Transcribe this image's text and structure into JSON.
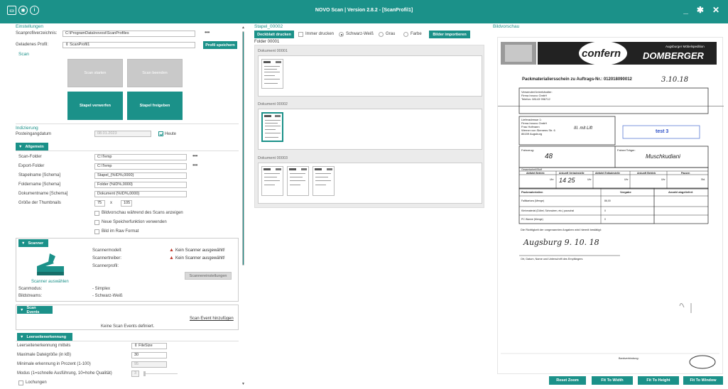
{
  "titlebar": {
    "title": "NOVO Scan  |  Version  2.8.2   -   [ScanProfil1]",
    "icons": [
      "scanner-icon",
      "gear-icon",
      "info-icon"
    ],
    "window_controls": [
      "_",
      "✱",
      "✕"
    ]
  },
  "left": {
    "einstellungen": "Einstellungen",
    "scanprofil_label": "Scanprofilverzeichnis:",
    "scanprofil_value": "C:\\ProgramData\\novosi\\ScanProfiles",
    "geladenes_label": "Geladenes Profil:",
    "geladenes_value": "ScanProfil1",
    "profil_speichern": "Profil speichern",
    "scan_title": "Scan",
    "scan_starten": "Scan starten",
    "scan_beenden": "Scan beenden",
    "stapel_verwerfen": "Stapel verwerfen",
    "stapel_freigeben": "Stapel freigeben",
    "indizierung_title": "Indizierung",
    "posteingang_label": "Posteingangdatum",
    "posteingang_value": "08.01.2023",
    "heute": "Heute",
    "allgemein": {
      "header": "Allgemein",
      "scan_folder_label": "Scan-Folder",
      "scan_folder_value": "C:\\Temp",
      "export_folder_label": "Export-Folder",
      "export_folder_value": "C:\\Temp",
      "stapelname_label": "Stapelname [Schema]",
      "stapelname_value": "Stapel_{%ID%,0000}",
      "foldername_label": "Foldername [Schema]",
      "foldername_value": "Folder {%ID%,0000}",
      "dokumentname_label": "Dokumentname [Schema]",
      "dokumentname_value": "Dokument {%ID%,0000}",
      "thumbs_label": "Größe der Thumbnails",
      "thumbs_w": "75",
      "thumbs_x": "x",
      "thumbs_h": "105",
      "cb1": "Bildvorschau während des Scans anzeigen",
      "cb2": "Neue Speicherfunktion verwenden",
      "cb3": "Bild im Raw Format"
    },
    "scanner": {
      "header": "Scanner",
      "scanner_auswaehlen": "Scanner auswählen",
      "modell_label": "Scannermodell:",
      "treiber_label": "Scannertreiber:",
      "profil_label": "Scannerprofil:",
      "modell_warn": "Kein Scanner ausgewählt!",
      "treiber_warn": "Kein Scanner ausgewählt!",
      "einstellungen_btn": "Scannereinstellungen",
      "modus_label": "Scanmodus:",
      "modus_value": "- Simplex",
      "streams_label": "Bildstreams:",
      "streams_value": "- Schwarz-Weiß"
    },
    "scan_events": {
      "header": "Scan Events",
      "add": "Scan Event hinzufügen",
      "none": "Keine Scan Events definiert."
    },
    "leerseiten": {
      "header": "Leerseitenerkennung",
      "mittels_label": "Leerseitenerkennung mittels",
      "mittels_value": "FileSize",
      "max_label": "Maximale Dateigröße (in kB)",
      "max_value": "30",
      "min_label": "Minimale erkennung in Prozent (1-100)",
      "min_value": "95",
      "modus_label": "Modus (1=schnelle Ausführung, 10=hohe Qualität)",
      "modus_value": "3",
      "lochungen": "Lochungen"
    }
  },
  "middle": {
    "stapel": "Stapel_00002",
    "deckblatt": "Deckblatt drucken",
    "immer_drucken": "Immer drucken",
    "sw": "Schwarz-Weiß",
    "grau": "Grau",
    "farbe": "Farbe",
    "bilder_importieren": "Bilder importieren",
    "folder": "Folder 00001",
    "docs": [
      {
        "label": "Dokument 00001",
        "thumbs": 1
      },
      {
        "label": "Dokument 00002",
        "thumbs": 1
      },
      {
        "label": "Dokument 00003",
        "thumbs": 3
      }
    ]
  },
  "right": {
    "title": "Bildvorschau",
    "doc": {
      "logo_conferm": "confern",
      "logo_sub": "Umzugs-Partner",
      "logo_top": "Augsburger Möbelspedition",
      "logo_brand": "DOMBERGER",
      "heading": "Packmaterialiersschein zu Auftrags-Nr.: 012018090012",
      "date_hand": "3.10.18",
      "versender": "Versender/Unterhändler:",
      "versender_name": "Firma Innovo GmbH",
      "versender_tel": "Telefon:  08143 996712",
      "liefer": "Lieferadresse 1:",
      "liefer_1": "Firma Innovo GmbH",
      "liefer_2": "Frau Hofmann",
      "liefer_3": "Werner von Siemens Str. 6",
      "liefer_hand": "III. mit Lift",
      "liefer_4": "86159 Augsburg",
      "test_box": "test 3",
      "fahrzeug": "Fahrzeug:",
      "fahrzeug_hand": "48",
      "fahrer": "Fahrer/Träger:",
      "fahrer_hand": "Muschkudiani",
      "gesamt": "Gesamtarbeit/Stoff",
      "col1": "Abfahrt Betrieb",
      "col2": "Ankunft Verladestelle",
      "col3": "Abfahrt Entladestelle",
      "col4": "Ankunft Betrieb",
      "col5": "Pausen",
      "uhr": "Uhr",
      "std": "Std.",
      "time_hand": "14 25",
      "pack_h1": "Packmaterialien",
      "pack_h2": "Vorgabe",
      "pack_h3": "Anzahl abgeliefert",
      "pack_r1": "Falltkartons (Menge)",
      "pack_r1v": "86,00",
      "pack_r2": "Kleinmaterial (Dübel, Schrauben, etc.) pauschal",
      "pack_r2v": "0",
      "pack_r3": "PC Wanne (Menge)",
      "pack_r3v": "0",
      "bestaetigt": "Die Richtigkeit der vorgenannten Angaben wird hiermit bestätigt:",
      "sig_hand": "Augsburg  9. 10. 18",
      "sig_label": "Ort, Datum, Name und Unterschrift des Empfängers",
      "footer_bank": "Bankverbindung:"
    },
    "reset_zoom": "Reset Zoom",
    "fit_width": "Fit To Width",
    "fit_height": "Fit To Height",
    "fit_window": "Fit To Window"
  },
  "colors": {
    "accent": "#1b9189",
    "warning": "#c0392b"
  }
}
